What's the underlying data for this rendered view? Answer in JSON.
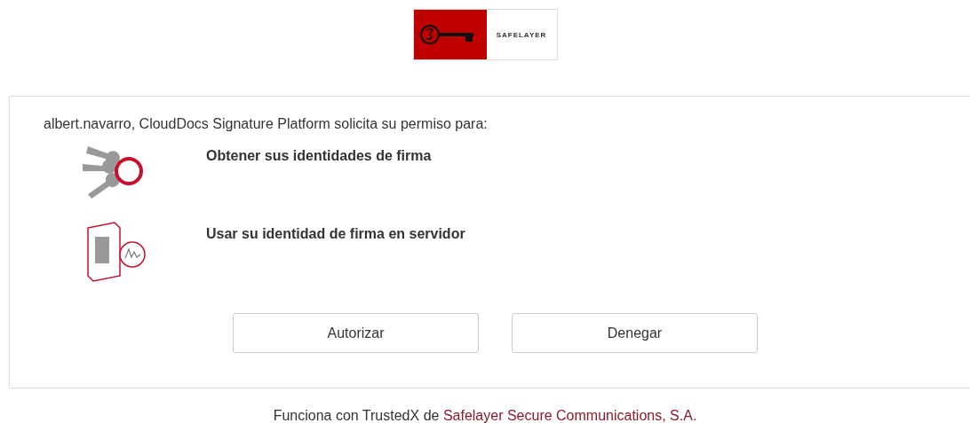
{
  "logo": {
    "text": "SAFELAYER"
  },
  "request": {
    "user": "albert.navarro,",
    "app": "CloudDocs Signature Platform",
    "action": "solicita su permiso para:"
  },
  "permissions": [
    {
      "kind": "keys",
      "label": "Obtener sus identidades de firma"
    },
    {
      "kind": "server",
      "label": "Usar su identidad de firma en servidor"
    }
  ],
  "buttons": [
    "Autorizar",
    "Denegar"
  ],
  "footer": {
    "text": "Funciona con TrustedX de",
    "link": "Safelayer Secure Communications, S.A."
  }
}
